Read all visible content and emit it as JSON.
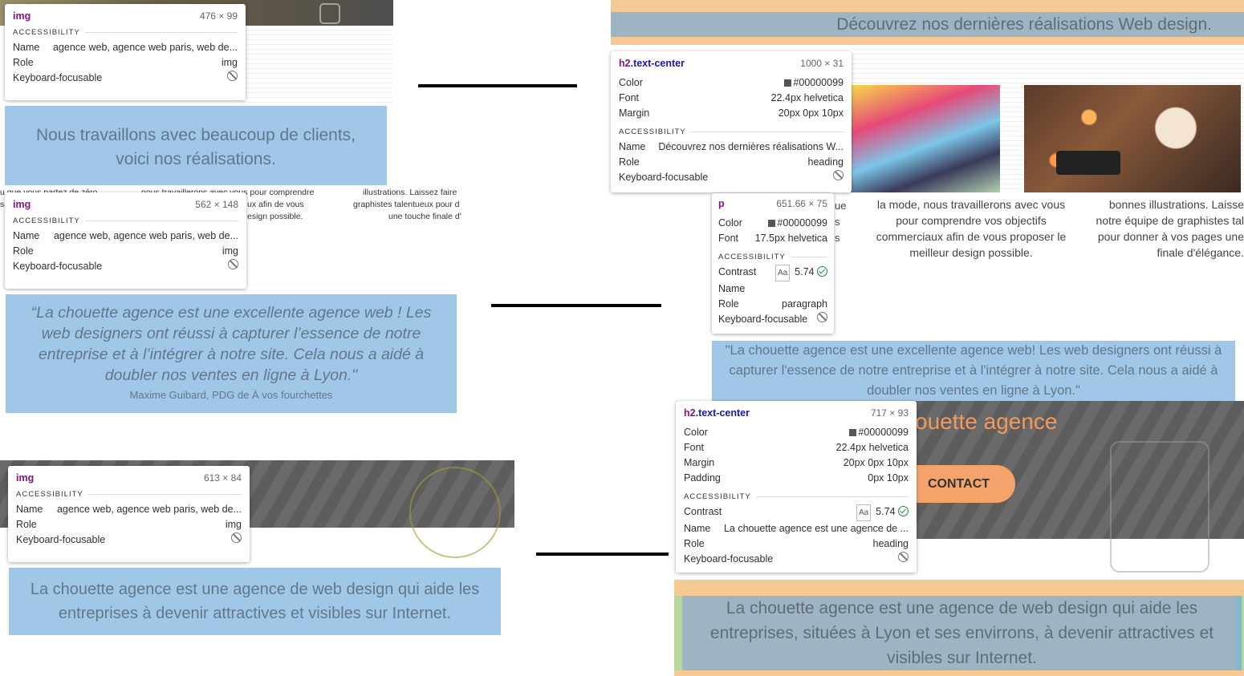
{
  "left": {
    "tooltip1": {
      "tag": "img",
      "dims": "476 × 99",
      "section": "ACCESSIBILITY",
      "name_label": "Name",
      "name_value": "agence web, agence web paris, web de...",
      "role_label": "Role",
      "role_value": "img",
      "kf_label": "Keyboard-focusable"
    },
    "heading1": "Nous travaillons avec beaucoup de clients, voici nos réalisations.",
    "snippets": [
      "u que vous partez de zéro",
      "nous travaillerons avec vous pour comprendre",
      "illustrations. Laissez faire",
      "se",
      "ux afin de vous",
      "graphistes talentueux pour d",
      "esign possible.",
      "une touche finale d'"
    ],
    "tooltip2": {
      "tag": "img",
      "dims": "562 × 148",
      "section": "ACCESSIBILITY",
      "name_label": "Name",
      "name_value": "agence web, agence web paris, web de...",
      "role_label": "Role",
      "role_value": "img",
      "kf_label": "Keyboard-focusable"
    },
    "quote": "“La chouette agence est une excellente agence web ! Les web designers ont réussi à capturer l’essence de notre entreprise et à l’intégrer à notre site. Cela nous a aidé à doubler nos ventes en ligne à Lyon.\"",
    "quote_author": "Maxime Guibard, PDG de À vos fourchettes",
    "tooltip3": {
      "tag": "img",
      "dims": "613 × 84",
      "section": "ACCESSIBILITY",
      "name_label": "Name",
      "name_value": "agence web, agence web paris, web de...",
      "role_label": "Role",
      "role_value": "img",
      "kf_label": "Keyboard-focusable"
    },
    "footer_text": "La chouette agence est une agence de web design qui aide les entreprises à devenir attractives et visibles sur Internet."
  },
  "right": {
    "heading1": "Découvrez nos dernières réalisations Web design.",
    "tooltip1": {
      "tag": "h2",
      "cls": ".text-center",
      "dims": "1000 × 31",
      "color_label": "Color",
      "color_value": "#00000099",
      "font_label": "Font",
      "font_value": "22.4px helvetica",
      "margin_label": "Margin",
      "margin_value": "20px 0px 10px",
      "section": "ACCESSIBILITY",
      "name_label": "Name",
      "name_value": "Découvrez nos dernières réalisations W...",
      "role_label": "Role",
      "role_value": "heading",
      "kf_label": "Keyboard-focusable"
    },
    "service_mid": "la mode, nous travaillerons avec vous pour comprendre vos objectifs commerciaux afin de vous proposer le meilleur design possible.",
    "service_right": "bonnes illustrations. Laisse notre équipe de graphistes tal pour donner à vos pages une finale d'élégance.",
    "snip_left": [
      "ue",
      "s",
      "s"
    ],
    "tooltip2": {
      "tag": "p",
      "dims": "651.66 × 75",
      "color_label": "Color",
      "color_value": "#00000099",
      "font_label": "Font",
      "font_value": "17.5px helvetica",
      "section": "ACCESSIBILITY",
      "contrast_label": "Contrast",
      "contrast_value": "5.74",
      "name_label": "Name",
      "role_label": "Role",
      "role_value": "paragraph",
      "kf_label": "Keyboard-focusable"
    },
    "quote": "\"La chouette agence est une excellente agence web! Les web designers ont réussi à capturer l'essence de notre entreprise et à l'intégrer à notre site. Cela nous a aidé à doubler nos ventes en ligne à Lyon.\"",
    "brand_heading": "ouette agence",
    "contact_button": "CONTACT",
    "tooltip3": {
      "tag": "h2",
      "cls": ".text-center",
      "dims": "717 × 93",
      "color_label": "Color",
      "color_value": "#00000099",
      "font_label": "Font",
      "font_value": "22.4px helvetica",
      "margin_label": "Margin",
      "margin_value": "20px 0px 10px",
      "padding_label": "Padding",
      "padding_value": "0px 10px",
      "section": "ACCESSIBILITY",
      "contrast_label": "Contrast",
      "contrast_value": "5.74",
      "name_label": "Name",
      "name_value": "La chouette agence est une agence de ...",
      "role_label": "Role",
      "role_value": "heading",
      "kf_label": "Keyboard-focusable"
    },
    "footer_text": "La chouette agence est une agence de web design qui aide les entreprises, situées à Lyon et ses envirrons, à devenir attractives et visibles sur Internet."
  },
  "colors": {
    "overlay": "#6fa8dc",
    "margin_overlay": "#f6c994",
    "contact": "#f4a46b",
    "brand_text": "#f39a5a",
    "tag": "#881280",
    "ok": "#1e8e3e"
  }
}
